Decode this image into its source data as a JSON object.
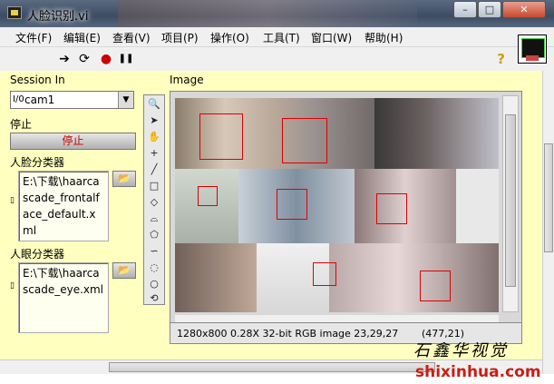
{
  "window": {
    "title": "人脸识别.vi",
    "minimize": "–",
    "maximize": "□",
    "close": "✕"
  },
  "menu": [
    "文件(F)",
    "编辑(E)",
    "查看(V)",
    "项目(P)",
    "操作(O)",
    "工具(T)",
    "窗口(W)",
    "帮助(H)"
  ],
  "toolbar": {
    "run": "➔",
    "run_continuous": "⟳",
    "abort": "●",
    "pause": "❚❚",
    "help": "?"
  },
  "session_in": {
    "label": "Session In",
    "index": "I/0",
    "value": "cam1"
  },
  "stop": {
    "label": "停止",
    "button": "停止"
  },
  "face_classifier": {
    "label": "人脸分类器",
    "path": "E:\\下载\\haarcascade_frontalface_default.xml"
  },
  "eye_classifier": {
    "label": "人眼分类器",
    "path": "E:\\下载\\haarcascade_eye.xml"
  },
  "image": {
    "label": "Image",
    "status": "1280x800 0.28X 32-bit RGB image 23,29,27",
    "coords": "(477,21)"
  },
  "watermark": {
    "line1": "石鑫华视觉",
    "line2": "shixinhua.com"
  },
  "colors": {
    "panel": "#ffffc0",
    "face_box": "#e00000",
    "stop_text": "#d00000"
  }
}
